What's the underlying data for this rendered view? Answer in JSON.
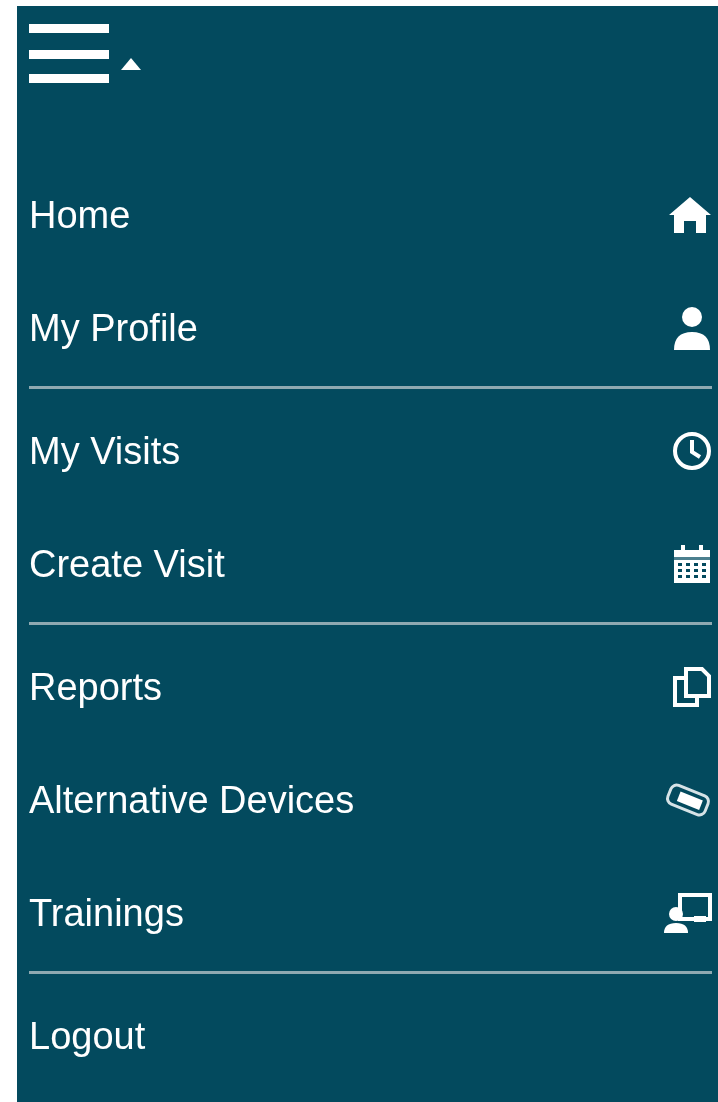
{
  "menu_toggle": {
    "expanded": true
  },
  "groups": [
    [
      {
        "label": "Home",
        "kind": "home"
      },
      {
        "label": "My Profile",
        "kind": "user"
      }
    ],
    [
      {
        "label": "My Visits",
        "kind": "clock"
      },
      {
        "label": "Create Visit",
        "kind": "calendar"
      }
    ],
    [
      {
        "label": "Reports",
        "kind": "copy"
      },
      {
        "label": "Alternative Devices",
        "kind": "tag"
      },
      {
        "label": "Trainings",
        "kind": "training"
      }
    ],
    [
      {
        "label": "Logout",
        "kind": "plain"
      }
    ]
  ]
}
